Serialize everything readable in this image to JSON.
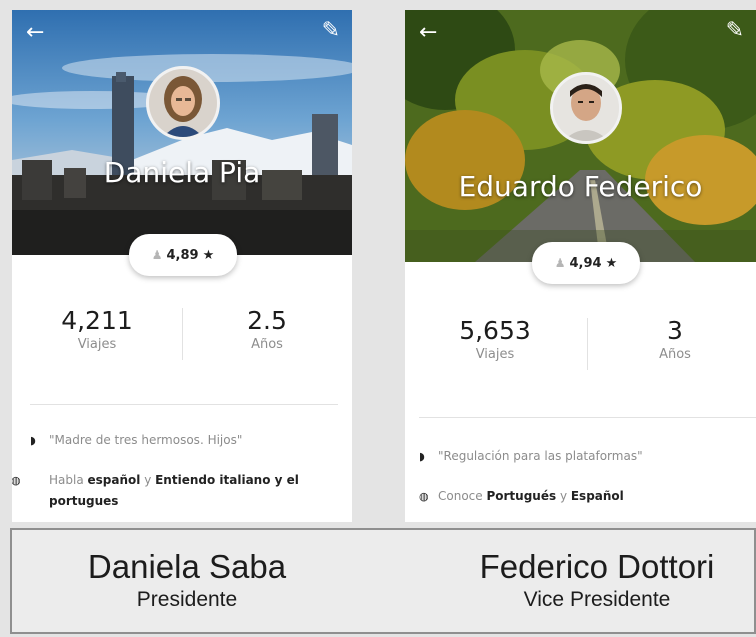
{
  "profiles": [
    {
      "name": "Daniela Pia",
      "rating": "4,89",
      "star": "★",
      "trips_value": "4,211",
      "trips_label": "Viajes",
      "years_value": "2.5",
      "years_label": "Años",
      "quote": "\"Madre de tres hermosos. Hijos\"",
      "lang_prefix": "Habla ",
      "lang_bold1": "español",
      "lang_mid": " y ",
      "lang_bold2": "Entiendo italiano y el portugues"
    },
    {
      "name": "Eduardo Federico",
      "rating": "4,94",
      "star": "★",
      "trips_value": "5,653",
      "trips_label": "Viajes",
      "years_value": "3",
      "years_label": "Años",
      "quote": "\"Regulación para las plataformas\"",
      "lang_prefix": "Conoce ",
      "lang_bold1": "Portugués",
      "lang_mid": " y ",
      "lang_bold2": "Español"
    }
  ],
  "captions": [
    {
      "name": "Daniela Saba",
      "role": "Presidente"
    },
    {
      "name": "Federico Dottori",
      "role": "Vice Presidente"
    }
  ],
  "icons": {
    "back": "←",
    "edit": "✎",
    "person": "♟",
    "quote": "◗",
    "globe": "◍"
  },
  "colors": {
    "accent_text": "#222222",
    "muted_text": "#8c8c8c"
  }
}
